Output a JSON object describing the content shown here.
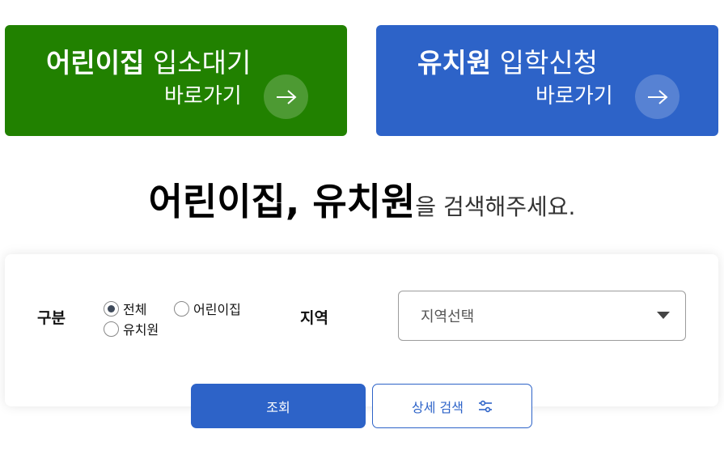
{
  "banners": {
    "daycare": {
      "title_bold": "어린이집",
      "title_light": "입소대기",
      "sub": "바로가기",
      "color": "#218100"
    },
    "kindergarten": {
      "title_bold": "유치원",
      "title_light": "입학신청",
      "sub": "바로가기",
      "color": "#2d63c8"
    }
  },
  "headline": {
    "strong": "어린이집, 유치원",
    "rest": "을 검색해주세요."
  },
  "search": {
    "category_label": "구분",
    "options": [
      {
        "label": "전체",
        "checked": true
      },
      {
        "label": "어린이집",
        "checked": false
      },
      {
        "label": "유치원",
        "checked": false
      }
    ],
    "region_label": "지역",
    "region_select": {
      "value": "지역선택"
    }
  },
  "buttons": {
    "search": "조회",
    "detail_search": "상세 검색"
  },
  "icons": {
    "arrow": "arrow-right-icon",
    "filter": "sliders-icon",
    "caret": "caret-down-icon"
  }
}
